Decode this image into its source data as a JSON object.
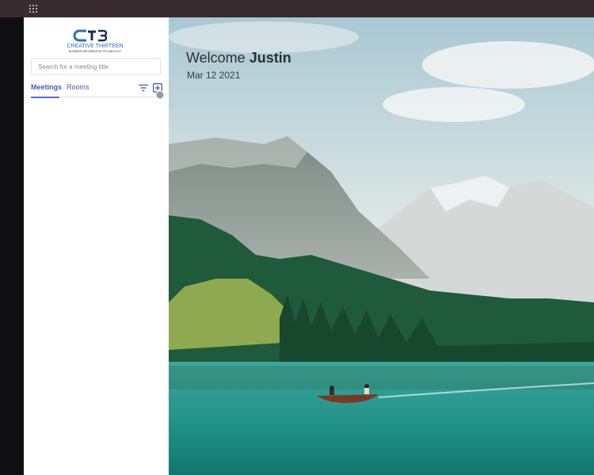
{
  "app": {
    "brand": {
      "logo_text": "CT3",
      "name": "CREATIVE THIRTEEN",
      "tagline": "BUSINESS INFORMATION TECHNOLOGY"
    }
  },
  "sidebar": {
    "search": {
      "placeholder": "Search for a meeting title",
      "value": ""
    },
    "tabs": [
      {
        "label": "Meetings",
        "active": true
      },
      {
        "label": "Rooms",
        "active": false
      }
    ],
    "icons": [
      "filter-icon",
      "add-meeting-icon"
    ]
  },
  "main": {
    "welcome_prefix": "Welcome",
    "user_name": "Justin",
    "date": "Mar 12 2021"
  },
  "colors": {
    "accent": "#4c5bb0",
    "topbar": "#3a2b30"
  }
}
